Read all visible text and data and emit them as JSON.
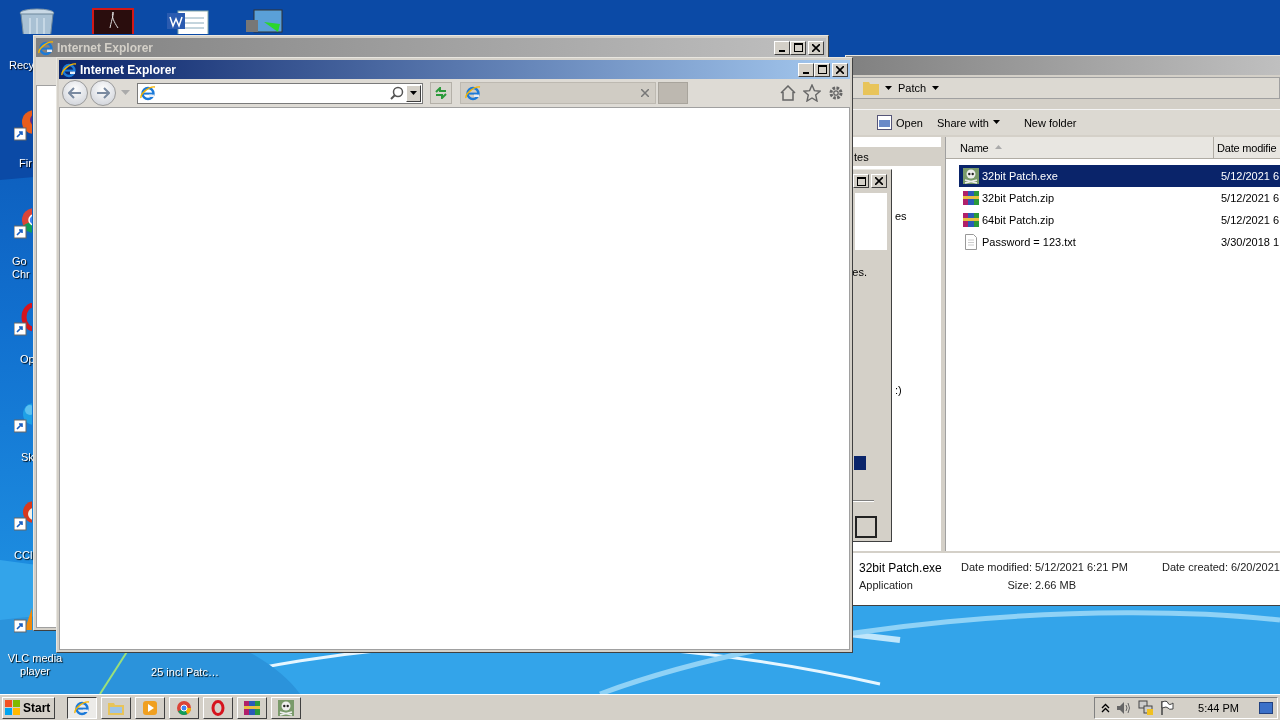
{
  "desktop_icons": [
    {
      "kind": "bin",
      "label": "Recy"
    },
    {
      "kind": "pdf"
    },
    {
      "kind": "doc"
    },
    {
      "kind": "setup"
    },
    {
      "kind": "fox",
      "label": "Fir"
    },
    {
      "kind": "wheel",
      "label": "Go\nChr"
    },
    {
      "kind": "ring",
      "label": "Op"
    },
    {
      "kind": "cloud",
      "label": "Sk"
    },
    {
      "kind": "brush",
      "label": "CCl"
    },
    {
      "kind": "cone",
      "label": "VLC media player"
    },
    {
      "kind": "none",
      "label": "25 incl Patc…"
    }
  ],
  "windows": [
    {
      "kind": "explorer",
      "active": false,
      "breadcrumb": "Patch",
      "toolbar": [
        {
          "kind": "icon",
          "label": "Open"
        },
        {
          "kind": "menu",
          "label": "Share with"
        },
        {
          "kind": "plain",
          "label": "New folder"
        }
      ],
      "nav_pane": {
        "header": "tes",
        "items": [
          "es",
          ":)"
        ]
      },
      "columns": [
        {
          "label": "Name",
          "sorted": true
        },
        {
          "label": "Date modifie"
        }
      ],
      "files": [
        {
          "kind": "exe",
          "name": "32bit Patch.exe",
          "date": "5/12/2021 6",
          "selected": true
        },
        {
          "kind": "zip",
          "name": "32bit Patch.zip",
          "date": "5/12/2021 6",
          "selected": false
        },
        {
          "kind": "zip",
          "name": "64bit Patch.zip",
          "date": "5/12/2021 6",
          "selected": false
        },
        {
          "kind": "txt",
          "name": "Password = 123.txt",
          "date": "3/30/2018 1",
          "selected": false
        }
      ],
      "details": {
        "name": "32bit Patch.exe",
        "type": "Application",
        "fields": [
          {
            "label": "Date modified:",
            "value": "5/12/2021 6:21 PM"
          },
          {
            "label": "Size:",
            "value": "2.66 MB"
          },
          {
            "label": "Date created:",
            "value": "6/20/2021"
          }
        ]
      }
    },
    {
      "kind": "dialog",
      "active": false,
      "text": "es."
    },
    {
      "kind": "browser",
      "title": "Internet Explorer",
      "active": false
    },
    {
      "kind": "browser",
      "title": "Internet Explorer",
      "active": true
    }
  ],
  "taskbar": {
    "start": "Start",
    "apps": [
      {
        "kind": "browser",
        "selected": true
      },
      {
        "kind": "folder",
        "selected": false
      },
      {
        "kind": "media",
        "selected": false
      },
      {
        "kind": "wheel",
        "selected": false
      },
      {
        "kind": "ring",
        "selected": false
      },
      {
        "kind": "archive",
        "selected": false
      },
      {
        "kind": "skull",
        "selected": false
      }
    ],
    "clock": "5:44 PM"
  }
}
